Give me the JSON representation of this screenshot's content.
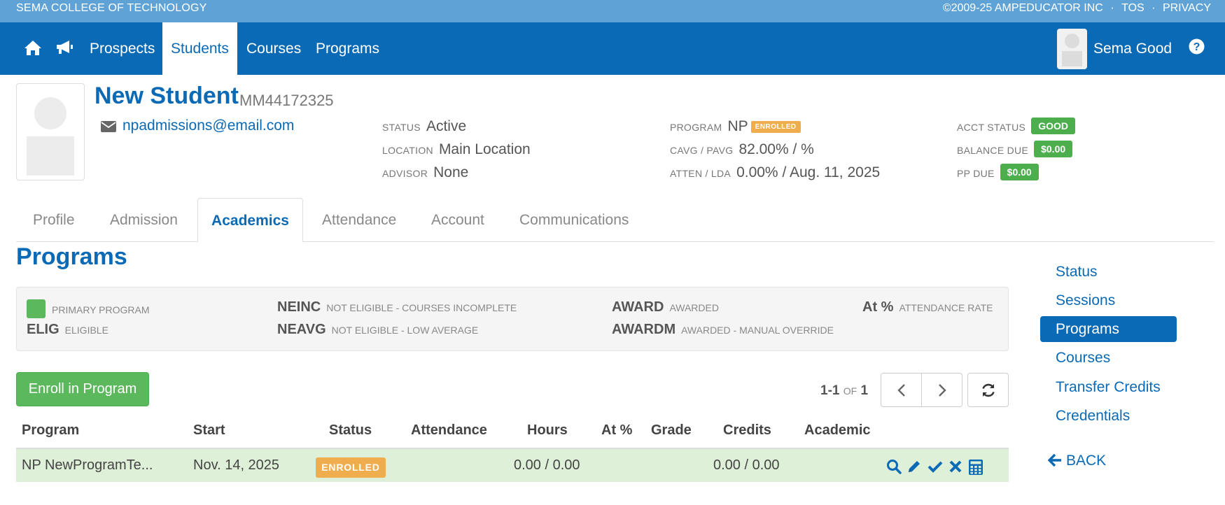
{
  "topbar": {
    "school_name": "SEMA COLLEGE OF TECHNOLOGY",
    "copyright": "©2009-25 AMPEDUCATOR INC",
    "sep1": "·",
    "tos": "TOS",
    "sep2": "·",
    "privacy": "PRIVACY"
  },
  "nav": {
    "items": [
      {
        "label": "Prospects"
      },
      {
        "label": "Students"
      },
      {
        "label": "Courses"
      },
      {
        "label": "Programs"
      }
    ],
    "user_name": "Sema Good"
  },
  "student": {
    "name": "New Student",
    "id": "MM44172325",
    "email": "npadmissions@email.com",
    "status_label": "STATUS",
    "status": "Active",
    "location_label": "LOCATION",
    "location": "Main Location",
    "advisor_label": "ADVISOR",
    "advisor": "None",
    "program_label": "PROGRAM",
    "program": "NP",
    "program_badge": "ENROLLED",
    "cavg_label": "CAVG / PAVG",
    "cavg": "82.00% / %",
    "atten_label": "ATTEN / LDA",
    "atten": "0.00% / Aug. 11, 2025",
    "acct_status_label": "ACCT STATUS",
    "acct_status": "GOOD",
    "balance_label": "BALANCE DUE",
    "balance": "$0.00",
    "pp_label": "PP DUE",
    "pp": "$0.00"
  },
  "tabs": [
    {
      "label": "Profile"
    },
    {
      "label": "Admission"
    },
    {
      "label": "Academics"
    },
    {
      "label": "Attendance"
    },
    {
      "label": "Account"
    },
    {
      "label": "Communications"
    }
  ],
  "section_title": "Programs",
  "legend": {
    "primary": "PRIMARY PROGRAM",
    "elig_code": "ELIG",
    "elig_desc": "ELIGIBLE",
    "neinc_code": "NEINC",
    "neinc_desc": "NOT ELIGIBLE - COURSES INCOMPLETE",
    "neavg_code": "NEAVG",
    "neavg_desc": "NOT ELIGIBLE - LOW AVERAGE",
    "award_code": "AWARD",
    "award_desc": "AWARDED",
    "awardm_code": "AWARDM",
    "awardm_desc": "AWARDED - MANUAL OVERRIDE",
    "at_code": "At %",
    "at_desc": "ATTENDANCE RATE"
  },
  "enroll_button": "Enroll in Program",
  "pager": {
    "range": "1-1",
    "of": "OF",
    "total": "1"
  },
  "table": {
    "headers": [
      "Program",
      "Start",
      "Status",
      "Attendance",
      "Hours",
      "At %",
      "Grade",
      "Credits",
      "Academic"
    ],
    "rows": [
      {
        "program": "NP NewProgramTe...",
        "start": "Nov. 14, 2025",
        "status": "ENROLLED",
        "hours": "0.00 / 0.00",
        "credits": "0.00 / 0.00"
      }
    ]
  },
  "sidenav": {
    "items": [
      {
        "label": "Status"
      },
      {
        "label": "Sessions"
      },
      {
        "label": "Programs"
      },
      {
        "label": "Courses"
      },
      {
        "label": "Transfer Credits"
      },
      {
        "label": "Credentials"
      }
    ],
    "back": "BACK"
  },
  "colors": {
    "primary": "#0b6ab5",
    "topstrip": "#5fa3d6",
    "success": "#5cb85c",
    "warning": "#f0ad4e",
    "row_highlight": "#dff0d8"
  },
  "icons": [
    "home-icon",
    "megaphone-icon",
    "help-icon",
    "envelope-icon",
    "chevron-left-icon",
    "chevron-right-icon",
    "refresh-icon",
    "search-icon",
    "pencil-icon",
    "check-icon",
    "times-icon",
    "calculator-icon",
    "arrow-left-icon"
  ]
}
